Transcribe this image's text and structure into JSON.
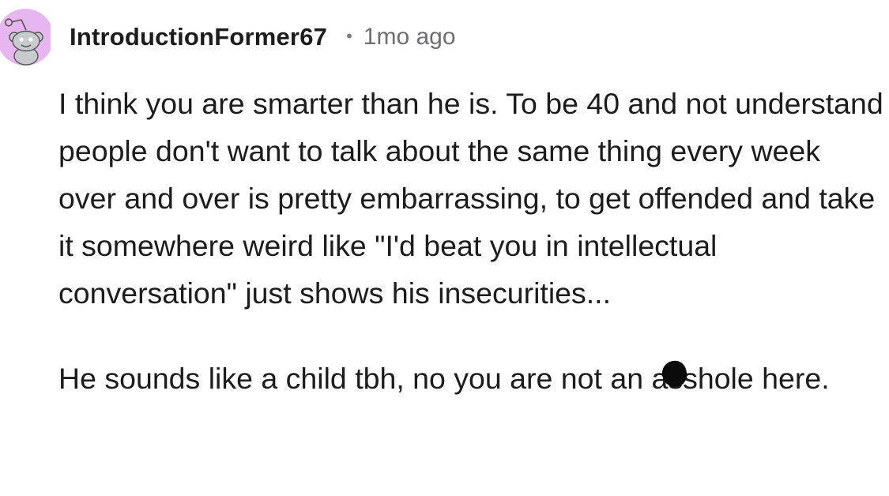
{
  "comment": {
    "username": "IntroductionFormer67",
    "separator": "•",
    "timestamp": "1mo ago",
    "avatar_icon": "reddit-snoo-avatar-icon",
    "avatar_bg_color": "#e7b6f0",
    "paragraphs": [
      "I think you are smarter than he is. To be 40 and not understand people don't want to talk about the same thing every week over and over is pretty embarrassing, to get offended and take it somewhere weird like \"I'd beat you in intellectual conversation\" just shows his insecurities...",
      "He sounds like a child tbh, no you are not an asshole here."
    ],
    "paragraph2_parts": {
      "before": "He sounds like a child tbh, no you are not an ",
      "censored_word": "asshole",
      "after": " here."
    }
  }
}
